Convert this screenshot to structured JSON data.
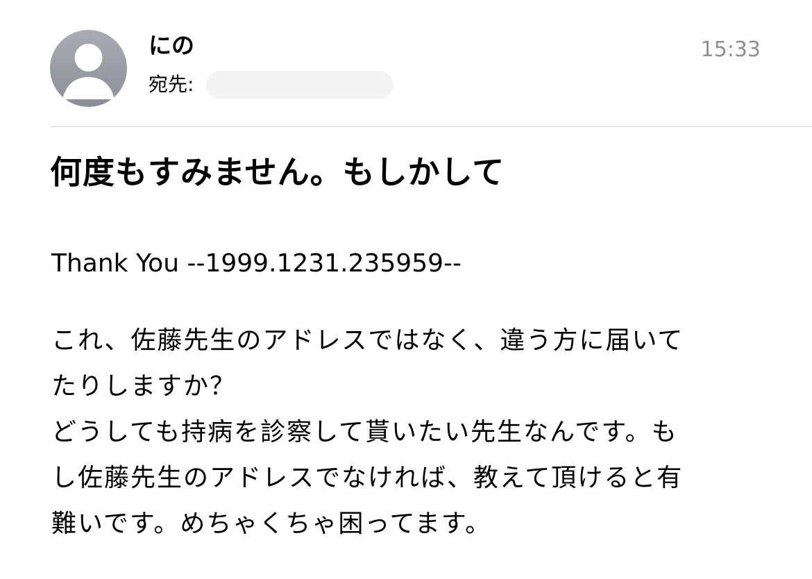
{
  "header": {
    "sender_name": "にの",
    "to_label": "宛先:",
    "time": "15:33"
  },
  "subject": "何度もすみません。もしかして",
  "body": {
    "lines": [
      "Thank You --1999.1231.235959--",
      "これ、佐藤先生のアドレスではなく、違う方に届いて",
      "たりしますか？",
      "どうしても持病を診察して貰いたい先生なんです。も",
      "し佐藤先生のアドレスでなければ、教えて頂けると有",
      "難いです。めちゃくちゃ困ってます。"
    ]
  },
  "icons": {
    "avatar": "person-silhouette-icon"
  },
  "colors": {
    "avatar_gray": "#9a9da6",
    "timestamp_gray": "#8e8e93",
    "divider": "#d6d6d9"
  }
}
